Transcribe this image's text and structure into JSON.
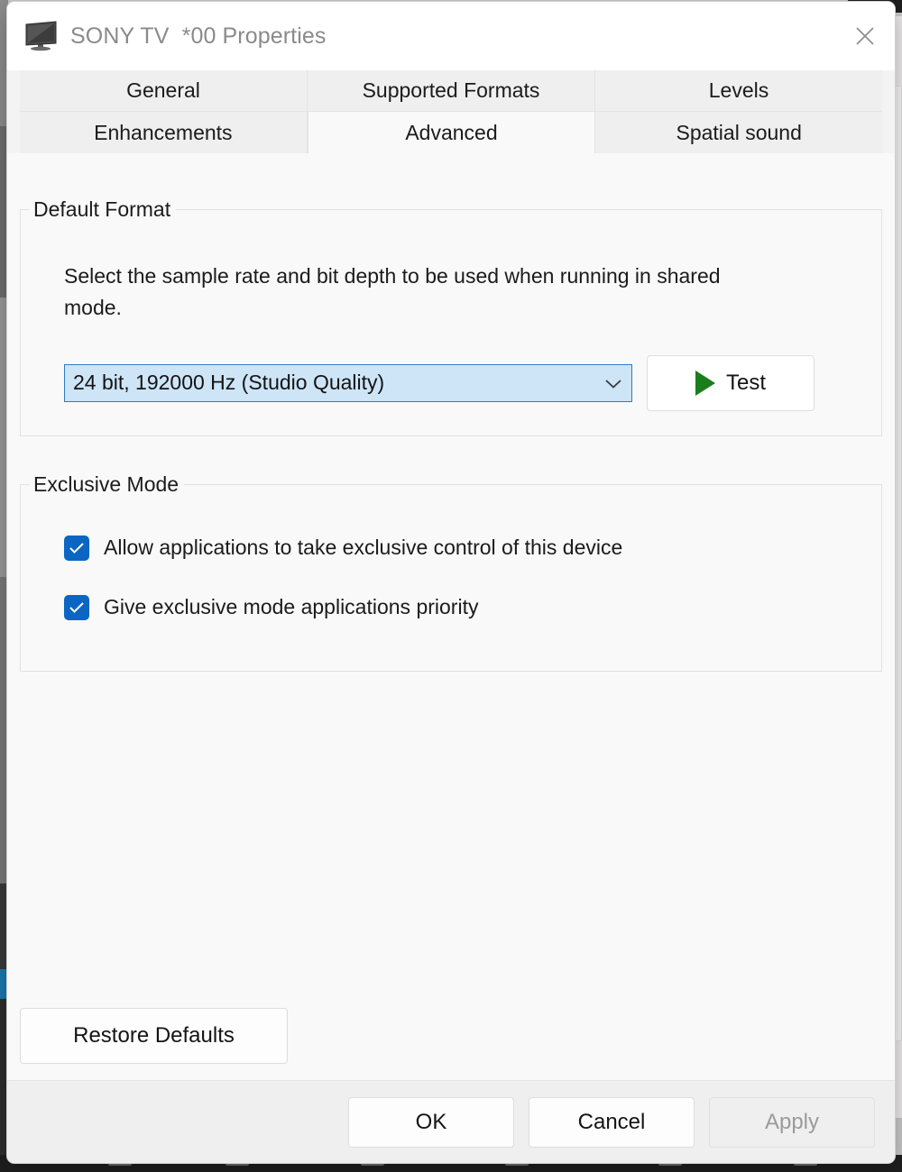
{
  "window": {
    "title": "SONY TV  *00 Properties",
    "icon": "tv-icon",
    "close_label": "✕"
  },
  "tabs": {
    "row1": [
      {
        "label": "General",
        "selected": false
      },
      {
        "label": "Supported Formats",
        "selected": false
      },
      {
        "label": "Levels",
        "selected": false
      }
    ],
    "row2": [
      {
        "label": "Enhancements",
        "selected": false
      },
      {
        "label": "Advanced",
        "selected": true
      },
      {
        "label": "Spatial sound",
        "selected": false
      }
    ]
  },
  "default_format": {
    "legend": "Default Format",
    "description": "Select the sample rate and bit depth to be used when running in shared mode.",
    "selected_format": "24 bit, 192000 Hz (Studio Quality)",
    "chevron": "⌄",
    "test_label": "Test"
  },
  "exclusive_mode": {
    "legend": "Exclusive Mode",
    "options": [
      {
        "label": "Allow applications to take exclusive control of this device",
        "checked": true
      },
      {
        "label": "Give exclusive mode applications priority",
        "checked": true
      }
    ]
  },
  "restore": {
    "label": "Restore Defaults"
  },
  "footer": {
    "ok": "OK",
    "cancel": "Cancel",
    "apply": "Apply",
    "apply_disabled": true
  },
  "colors": {
    "accent_blue": "#0a66c2",
    "combo_fill": "#cce4f7",
    "combo_border": "#2e7cc4",
    "play_green": "#1b7d1b",
    "title_text": "#8a8a8a",
    "dialog_bg": "#f9f9f9"
  }
}
